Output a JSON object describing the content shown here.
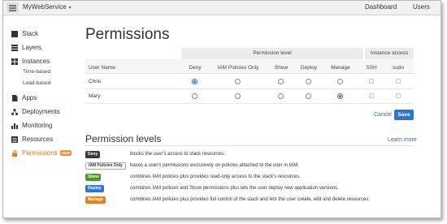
{
  "topbar": {
    "stack_name": "MyWebService",
    "caret": "▾",
    "dashboard": "Dashboard",
    "users": "Users"
  },
  "sidebar": {
    "items": [
      {
        "label": "Stack",
        "icon": "stack-icon"
      },
      {
        "label": "Layers",
        "icon": "layers-icon"
      },
      {
        "label": "Instances",
        "icon": "instances-icon"
      },
      {
        "label": "Apps",
        "icon": "apps-icon"
      },
      {
        "label": "Deployments",
        "icon": "deployments-icon"
      },
      {
        "label": "Monitoring",
        "icon": "monitoring-icon"
      },
      {
        "label": "Resources",
        "icon": "resources-icon"
      },
      {
        "label": "Permissions",
        "icon": "lock-icon",
        "badge": "NEW"
      }
    ],
    "sub_items": [
      "Time-based",
      "Load-based"
    ]
  },
  "main": {
    "title": "Permissions",
    "table": {
      "group_permission_level": "Permission level",
      "group_instance_access": "Instance access",
      "columns": [
        "User Name",
        "Deny",
        "IAM Policies Only",
        "Show",
        "Deploy",
        "Manage",
        "SSH",
        "sudo"
      ],
      "rows": [
        {
          "name": "Chris",
          "selected_level": "Deny",
          "ssh": false,
          "sudo": false
        },
        {
          "name": "Mary",
          "selected_level": "Manage",
          "ssh": false,
          "sudo": false
        }
      ]
    },
    "cancel": "Cancel",
    "save": "Save"
  },
  "levels": {
    "title": "Permission levels",
    "learn_more": "Learn more",
    "items": [
      {
        "badge": "Deny",
        "color": "#3a3a3a",
        "desc": "blocks the user's access to stack resources."
      },
      {
        "badge": "IAM Policies Only",
        "color": "#ffffff",
        "desc": "bases a user's permissions exclusively on policies attached to the user in IAM."
      },
      {
        "badge": "Show",
        "color": "#4a9a2c",
        "desc": "combines IAM policies plus provides read-only access to the stack's resources."
      },
      {
        "badge": "Deploy",
        "color": "#2b73d5",
        "desc": "combines IAM policies and Show permissions plus lets the user deploy new application versions."
      },
      {
        "badge": "Manage",
        "color": "#e8821e",
        "desc": "combines IAM policies plus provides full control of the stack and lets the user create, edit and delete resources."
      }
    ]
  },
  "colors": {
    "accent": "#2b73d5",
    "active_nav": "#e07b26",
    "link": "#2a6ac4"
  }
}
